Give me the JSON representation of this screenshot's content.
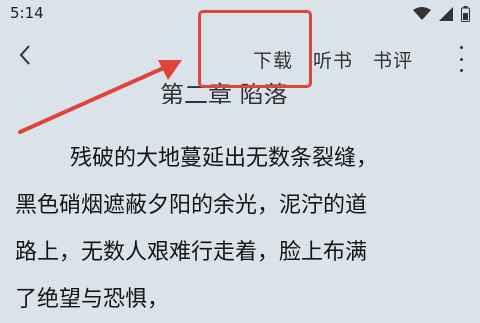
{
  "status_bar": {
    "time": "5:14"
  },
  "toolbar": {
    "download_label": "下载",
    "listen_label": "听书",
    "review_label": "书评"
  },
  "chapter_title": "第二章 陷落",
  "content": {
    "paragraph_1": "残破的大地蔓延出无数条裂缝，",
    "line_2": "黑色硝烟遮蔽夕阳的余光，泥泞的道",
    "line_3": "路上，无数人艰难行走着，脸上布满",
    "line_4": "了绝望与恐惧，"
  },
  "annotation": {
    "highlight_color": "#e0443a"
  }
}
